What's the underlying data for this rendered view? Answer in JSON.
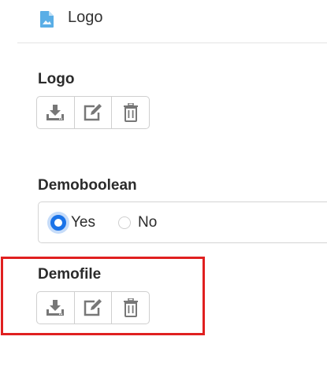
{
  "header": {
    "title": "Logo",
    "icon": "image-file-icon"
  },
  "fields": {
    "logo": {
      "label": "Logo"
    },
    "demoboolean": {
      "label": "Demoboolean",
      "options": [
        {
          "label": "Yes",
          "checked": true
        },
        {
          "label": "No",
          "checked": false
        }
      ]
    },
    "demofile": {
      "label": "Demofile"
    }
  },
  "actions": [
    "download-icon",
    "edit-icon",
    "trash-icon"
  ],
  "colors": {
    "accent": "#1a73e8",
    "highlight": "#e02020",
    "icon": "#777777"
  }
}
